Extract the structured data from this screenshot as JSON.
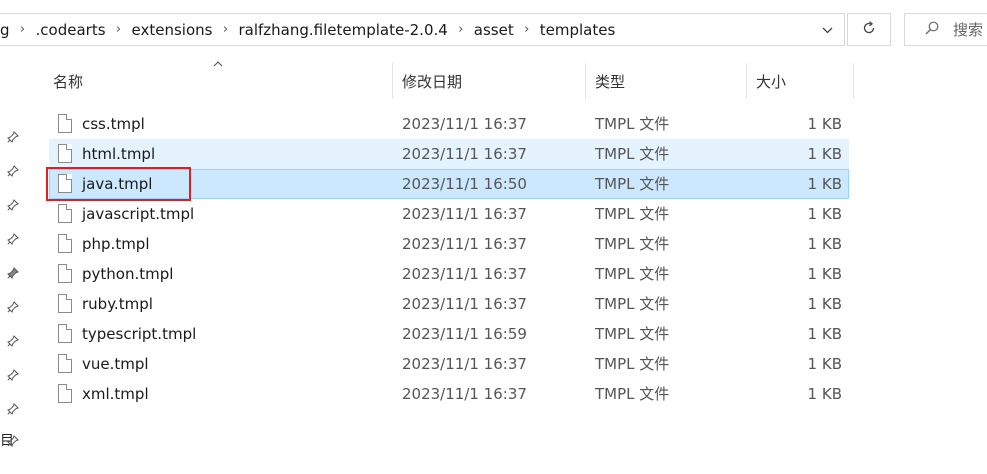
{
  "address_bar": {
    "crumbs": [
      "g",
      ".codearts",
      "extensions",
      "ralfzhang.filetemplate-2.0.4",
      "asset",
      "templates"
    ],
    "separator": "›"
  },
  "search": {
    "placeholder": "搜索"
  },
  "icons": {
    "dropdown": "chevron-down-icon",
    "refresh": "refresh-icon",
    "search": "search-icon",
    "pin": "pin-icon",
    "file": "file-icon"
  },
  "nav_pane": {
    "partial_label": "目"
  },
  "columns": {
    "name": "名称",
    "date": "修改日期",
    "type": "类型",
    "size": "大小"
  },
  "files": [
    {
      "name": "css.tmpl",
      "date": "2023/11/1 16:37",
      "type": "TMPL 文件",
      "size": "1 KB",
      "state": "normal"
    },
    {
      "name": "html.tmpl",
      "date": "2023/11/1 16:37",
      "type": "TMPL 文件",
      "size": "1 KB",
      "state": "hover"
    },
    {
      "name": "java.tmpl",
      "date": "2023/11/1 16:50",
      "type": "TMPL 文件",
      "size": "1 KB",
      "state": "selected"
    },
    {
      "name": "javascript.tmpl",
      "date": "2023/11/1 16:37",
      "type": "TMPL 文件",
      "size": "1 KB",
      "state": "normal"
    },
    {
      "name": "php.tmpl",
      "date": "2023/11/1 16:37",
      "type": "TMPL 文件",
      "size": "1 KB",
      "state": "normal"
    },
    {
      "name": "python.tmpl",
      "date": "2023/11/1 16:37",
      "type": "TMPL 文件",
      "size": "1 KB",
      "state": "normal"
    },
    {
      "name": "ruby.tmpl",
      "date": "2023/11/1 16:37",
      "type": "TMPL 文件",
      "size": "1 KB",
      "state": "normal"
    },
    {
      "name": "typescript.tmpl",
      "date": "2023/11/1 16:59",
      "type": "TMPL 文件",
      "size": "1 KB",
      "state": "normal"
    },
    {
      "name": "vue.tmpl",
      "date": "2023/11/1 16:37",
      "type": "TMPL 文件",
      "size": "1 KB",
      "state": "normal"
    },
    {
      "name": "xml.tmpl",
      "date": "2023/11/1 16:37",
      "type": "TMPL 文件",
      "size": "1 KB",
      "state": "normal"
    }
  ],
  "colors": {
    "hover_bg": "#e5f3ff",
    "selected_bg": "#cce8ff",
    "selected_border": "#99d1ff",
    "annotation_red": "#e02020"
  }
}
